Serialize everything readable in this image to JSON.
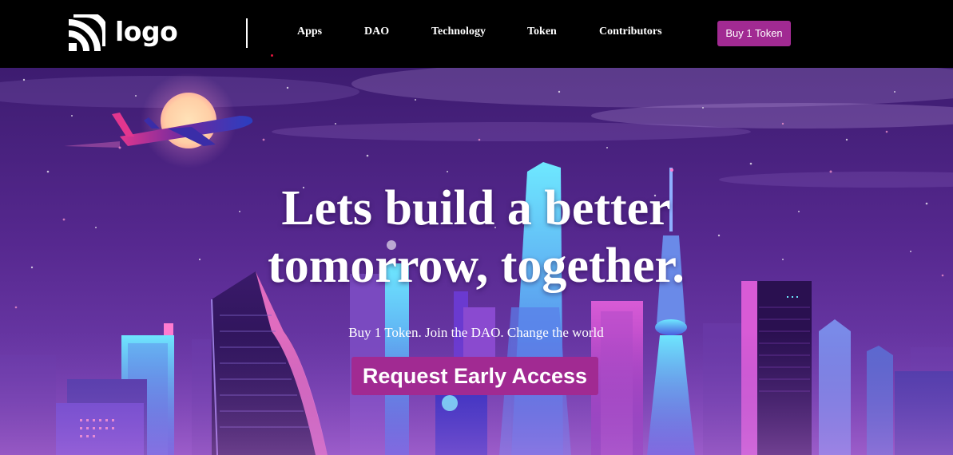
{
  "nav": {
    "logo_text": "logo",
    "links": [
      "Apps",
      "DAO",
      "Technology",
      "Token",
      "Contributors"
    ],
    "buy_label": "Buy 1 Token"
  },
  "hero": {
    "title": "Lets build a better tomorrow, together.",
    "subtitle": "Buy 1 Token. Join the DAO. Change the world",
    "cta_label": "Request Early Access"
  },
  "colors": {
    "accent": "#a12a92",
    "nav_bg": "#000000",
    "sky_top": "#3d1c70",
    "sky_bottom": "#6a3aa8"
  },
  "icons": {
    "logo": "signal-arcs-icon",
    "airplane": "airplane-illustration",
    "moon": "moon-illustration"
  }
}
